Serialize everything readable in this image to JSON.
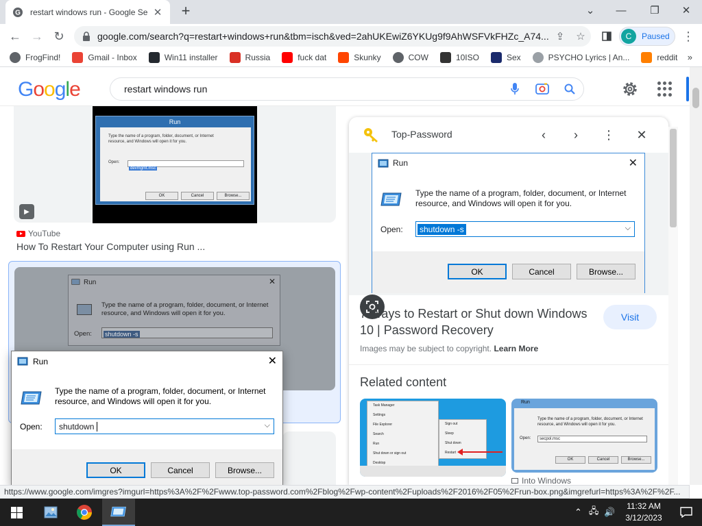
{
  "browser": {
    "tab_title": "restart windows run - Google Se",
    "new_tab_icon": "+",
    "url": "google.com/search?q=restart+windows+run&tbm=isch&ved=2ahUKEwiZ6YKUg9f9AhWSFVkFHZc_A74...",
    "profile_initial": "C",
    "profile_label": "Paused"
  },
  "bookmarks": [
    {
      "label": "FrogFind!",
      "icon": "globe-icon",
      "color": "#5f6368"
    },
    {
      "label": "Gmail - Inbox",
      "icon": "gmail-icon",
      "color": "#ea4335"
    },
    {
      "label": "Win11 installer",
      "icon": "github-icon",
      "color": "#24292f"
    },
    {
      "label": "Russia",
      "icon": "bookmark-icon",
      "color": "#d93025"
    },
    {
      "label": "fuck dat",
      "icon": "youtube-icon",
      "color": "#ff0000"
    },
    {
      "label": "Skunky",
      "icon": "reddit-icon",
      "color": "#ff4500"
    },
    {
      "label": "COW",
      "icon": "globe-icon",
      "color": "#5f6368"
    },
    {
      "label": "10ISO",
      "icon": "building-icon",
      "color": "#333333"
    },
    {
      "label": "Sex",
      "icon": "s-icon",
      "color": "#1a2a6c"
    },
    {
      "label": "PSYCHO Lyrics | An...",
      "icon": "loading-icon",
      "color": "#9aa0a6"
    },
    {
      "label": "reddit",
      "icon": "rainbow-icon",
      "color": "#ff7f00"
    }
  ],
  "bookmarks_more": "»",
  "search": {
    "logo": "Google",
    "query": "restart windows run"
  },
  "results": {
    "video_source": "YouTube",
    "video_title": "How To Restart Your Computer using Run ...",
    "video_shot": {
      "title": "Run",
      "field_value": "devmgmt.msc",
      "line1": "Type the name of a program, folder, document, or Internet",
      "line2": "resource, and Windows will open it for you.",
      "open_label": "Open:",
      "ok": "OK",
      "cancel": "Cancel",
      "browse": "Browse..."
    },
    "dim_run": {
      "title": "Run",
      "message": "Type the name of a program, folder, document, or Internet resource, and Windows will open it for you.",
      "open_label": "Open:",
      "field_value": "shutdown -s"
    }
  },
  "run_dialog": {
    "title": "Run",
    "message": "Type the name of a program, folder, document, or Internet resource, and Windows will open it for you.",
    "open_label": "Open:",
    "value": "shutdown",
    "ok": "OK",
    "cancel": "Cancel",
    "browse": "Browse..."
  },
  "preview": {
    "site": "Top-Password",
    "run": {
      "title": "Run",
      "message": "Type the name of a program, folder, document, or Internet resource, and Windows will open it for you.",
      "open_label": "Open:",
      "value": "shutdown -s",
      "ok": "OK",
      "cancel": "Cancel",
      "browse": "Browse..."
    },
    "title": "7 Ways to Restart or Shut down Windows 10 | Password Recovery",
    "visit": "Visit",
    "copyright": "Images may be subject to copyright.",
    "learn_more": "Learn More",
    "related_heading": "Related content",
    "rel1_menu": [
      "Task Manager",
      "Settings",
      "File Explorer",
      "Search",
      "Run",
      "Shut down or sign out",
      "Desktop"
    ],
    "rel1_sub": [
      "Sign out",
      "Sleep",
      "Shut down",
      "Restart"
    ],
    "rel2": {
      "title": "Run",
      "message": "Type the name of a program, folder, document, or Internet resource, and Windows will open it for you.",
      "open_label": "Open:",
      "value": "secpol.msc",
      "ok": "OK",
      "cancel": "Cancel",
      "browse": "Browse..."
    },
    "rel2_caption": "Into Windows"
  },
  "status_url": "https://www.google.com/imgres?imgurl=https%3A%2F%2Fwww.top-password.com%2Fblog%2Fwp-content%2Fuploads%2F2016%2F05%2Frun-box.png&imgrefurl=https%3A%2F%2F...",
  "taskbar": {
    "time": "11:32 AM",
    "date": "3/12/2023"
  }
}
